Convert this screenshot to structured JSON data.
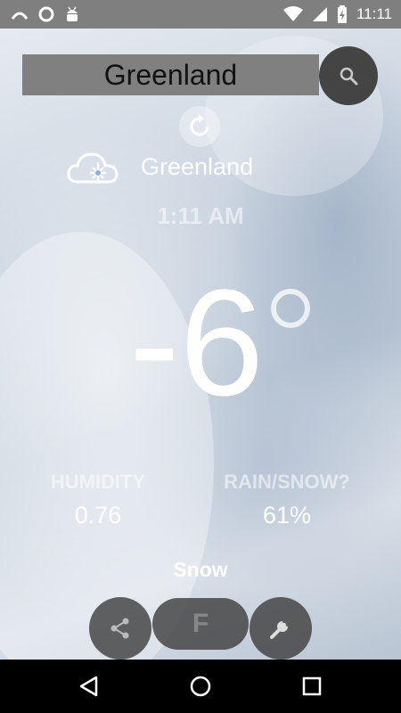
{
  "status_bar": {
    "time": "11:11",
    "icons": [
      "arc-icon",
      "circle-icon",
      "android-icon",
      "wifi-icon",
      "signal-icon",
      "battery-icon"
    ]
  },
  "search": {
    "value": "Greenland",
    "icon": "search-icon"
  },
  "weather": {
    "location": "Greenland",
    "time": "1:11 AM",
    "temperature": "-6",
    "icon": "snow-cloud-icon",
    "humidity_label": "HUMIDITY",
    "humidity_value": "0.76",
    "precip_label": "RAIN/SNOW?",
    "precip_value": "61%",
    "condition": "Snow"
  },
  "actions": {
    "unit_label": "F",
    "share_icon": "share-icon",
    "settings_icon": "wrench-icon",
    "refresh_icon": "refresh-icon"
  },
  "nav": {
    "icons": [
      "back-icon",
      "home-icon",
      "recents-icon"
    ]
  }
}
